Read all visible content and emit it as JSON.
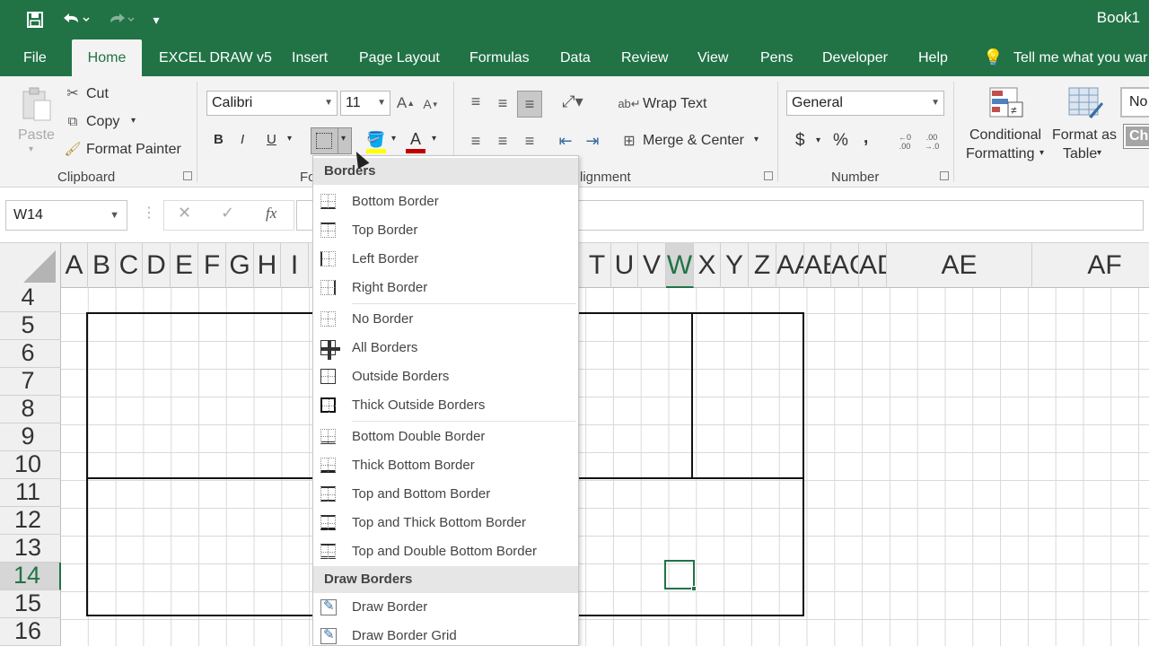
{
  "window": {
    "title": "Book1"
  },
  "qat": {
    "save_icon": "save-icon",
    "undo_icon": "undo-icon",
    "redo_icon": "redo-icon",
    "customize_icon": "customize-qat-icon"
  },
  "tabs": [
    {
      "label": "File"
    },
    {
      "label": "Home",
      "active": true
    },
    {
      "label": "EXCEL DRAW v5"
    },
    {
      "label": "Insert"
    },
    {
      "label": "Page Layout"
    },
    {
      "label": "Formulas"
    },
    {
      "label": "Data"
    },
    {
      "label": "Review"
    },
    {
      "label": "View"
    },
    {
      "label": "Pens"
    },
    {
      "label": "Developer"
    },
    {
      "label": "Help"
    },
    {
      "label": "Tell me what you war"
    }
  ],
  "ribbon": {
    "clipboard": {
      "paste": "Paste",
      "cut": "Cut",
      "copy": "Copy",
      "format_painter": "Format Painter",
      "group": "Clipboard"
    },
    "font": {
      "font_name": "Calibri",
      "font_size": "11",
      "bold": "B",
      "italic": "I",
      "underline": "U",
      "group": "Fo"
    },
    "alignment": {
      "wrap_text": "Wrap Text",
      "merge_center": "Merge & Center",
      "group": "lignment"
    },
    "number": {
      "format": "General",
      "currency": "$",
      "percent": "%",
      "comma": ",",
      "group": "Number"
    },
    "styles": {
      "conditional_1": "Conditional",
      "conditional_2": "Formatting",
      "format_table_1": "Format as",
      "format_table_2": "Table",
      "normal": "No",
      "check": "Ch"
    }
  },
  "formula_bar": {
    "name_box": "W14",
    "fx": "fx",
    "cancel": "✕",
    "enter": "✓",
    "value": ""
  },
  "columns": [
    "A",
    "B",
    "C",
    "D",
    "E",
    "F",
    "G",
    "H",
    "I",
    "T",
    "U",
    "V",
    "W",
    "X",
    "Y",
    "Z",
    "AA",
    "AB",
    "AC",
    "AD",
    "AE",
    "AF"
  ],
  "rows": [
    "4",
    "5",
    "6",
    "7",
    "8",
    "9",
    "10",
    "11",
    "12",
    "13",
    "14",
    "15",
    "16"
  ],
  "selected": {
    "column": "W",
    "row": "14"
  },
  "borders_menu": {
    "heading": "Borders",
    "items": [
      {
        "label": "Bottom Border"
      },
      {
        "label": "Top Border"
      },
      {
        "label": "Left Border"
      },
      {
        "label": "Right Border"
      },
      {
        "label": "No Border"
      },
      {
        "label": "All Borders"
      },
      {
        "label": "Outside Borders"
      },
      {
        "label": "Thick Outside Borders"
      },
      {
        "label": "Bottom Double Border"
      },
      {
        "label": "Thick Bottom Border"
      },
      {
        "label": "Top and Bottom Border"
      },
      {
        "label": "Top and Thick Bottom Border"
      },
      {
        "label": "Top and Double Bottom Border"
      }
    ],
    "draw_heading": "Draw Borders",
    "draw_items": [
      {
        "label": "Draw Border"
      },
      {
        "label": "Draw Border Grid"
      }
    ]
  },
  "colors": {
    "brand": "#217346",
    "ribbon_bg": "#f3f3f3",
    "font_color_bar": "#c00000",
    "highlight_bar": "#ffff00"
  }
}
